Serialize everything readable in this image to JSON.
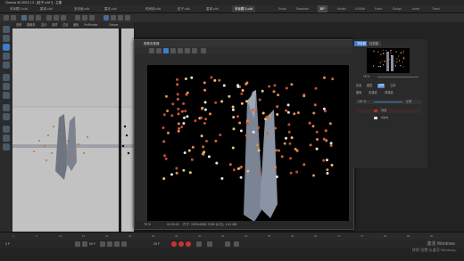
{
  "app": {
    "title": "Cinema 4D 2023.1.3 - [粒子.c4d *] - 主要"
  },
  "doc_tabs": [
    "未标题 1.c4d",
    "星球.c4d",
    "多页面.c4d",
    "露天.c4d",
    "时间线.c4d",
    "粒子.c4d",
    "星球.c4d",
    "未标题 1.c4d"
  ],
  "layouts": {
    "items": [
      "Script",
      "Standard",
      "BP",
      "Model",
      "UVEdit",
      "Paint",
      "Sculpt",
      "Anim",
      "Track"
    ],
    "active": "BP"
  },
  "viewport": {
    "menu": [
      "查看",
      "摄像机",
      "显示",
      "选项",
      "过滤",
      "面板",
      "ProRender",
      "Octane"
    ]
  },
  "picture_viewer": {
    "title": "图像查看器",
    "status_zoom": "75 %",
    "status_time": "00:00:24",
    "status_info": "尺寸: 1920x1080, RGB (8 位), 1.61 MB"
  },
  "side_panel": {
    "tabs": [
      "导航器",
      "柱状图"
    ],
    "zoom": "75 %",
    "rows": [
      {
        "a": "信息",
        "b": "图层",
        "c": "滤镜",
        "d": "立体"
      },
      {
        "a": "图像",
        "b": "多通道",
        "c": "单通道"
      },
      {
        "a": "100 %",
        "b": "正常"
      }
    ],
    "layer_name": "背景",
    "layer_alpha": "Alpha"
  },
  "timeline": {
    "ticks": [
      "0",
      "5",
      "10",
      "15",
      "20",
      "25",
      "30",
      "35",
      "40",
      "45",
      "50",
      "55",
      "60",
      "65",
      "70",
      "75",
      "80",
      "85",
      "90"
    ]
  },
  "playback": {
    "frame_current": "0 F",
    "frame_end": "90 F",
    "fps": "25 F"
  },
  "watermark": {
    "line1": "激活 Windows",
    "line2": "转到\"设置\"以激活 Windows。"
  },
  "colors": {
    "accent": "#3d7cc9",
    "record": "#cc3333"
  }
}
